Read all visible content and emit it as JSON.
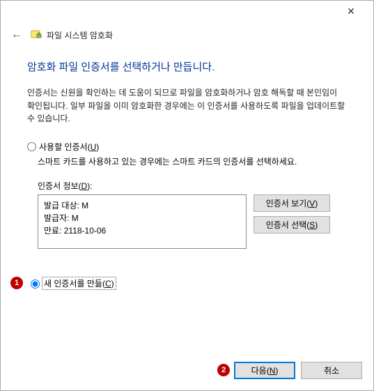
{
  "window": {
    "close_glyph": "✕"
  },
  "header": {
    "back_glyph": "←",
    "title": "파일 시스템 암호화"
  },
  "main": {
    "heading": "암호화 파일 인증서를 선택하거나 만듭니다.",
    "description": "인증서는 신원을 확인하는 데 도움이 되므로 파일을 암호화하거나 암호 해독할 때 본인임이 확인됩니다. 일부 파일을 이미 암호화한 경우에는 이 인증서를 사용하도록 파일을 업데이트할 수 있습니다."
  },
  "option_use": {
    "label_prefix": "사용할 인증서(",
    "label_access": "U",
    "label_suffix": ")",
    "subtext": "스마트 카드를 사용하고 있는 경우에는 스마트 카드의 인증서를 선택하세요."
  },
  "cert_info": {
    "label_prefix": "인증서 정보(",
    "label_access": "D",
    "label_suffix": "):",
    "issued_to": "발급 대상: M",
    "issued_by": "발급자: M",
    "expiry": "만료: 2118-10-06"
  },
  "buttons": {
    "view_prefix": "인증서 보기(",
    "view_access": "V",
    "view_suffix": ")",
    "select_prefix": "인증서 선택(",
    "select_access": "S",
    "select_suffix": ")"
  },
  "option_create": {
    "label_prefix": "새 인증서를 만듦(",
    "label_access": "C",
    "label_suffix": ")"
  },
  "footer": {
    "next_prefix": "다음(",
    "next_access": "N",
    "next_suffix": ")",
    "cancel": "취소"
  },
  "callouts": {
    "c1": "1",
    "c2": "2"
  }
}
